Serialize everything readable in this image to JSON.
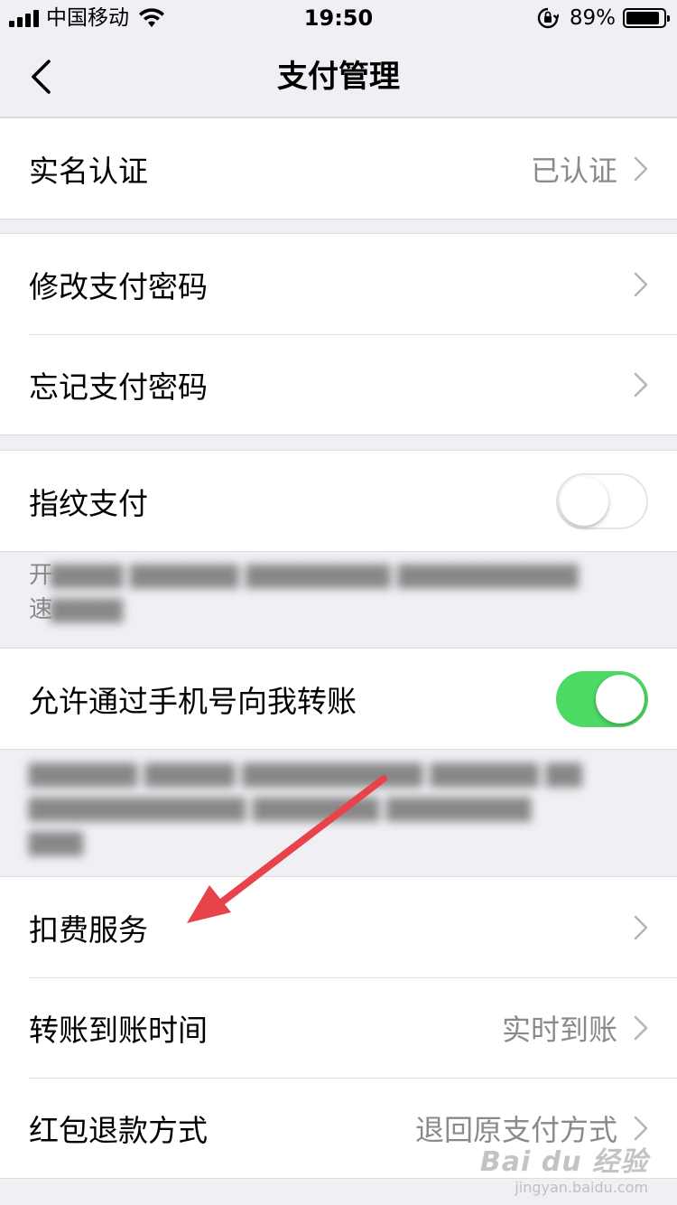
{
  "status_bar": {
    "carrier": "中国移动",
    "time": "19:50",
    "battery_percent": "89%",
    "battery_level": 0.89
  },
  "nav": {
    "title": "支付管理",
    "back_icon": "chevron-left-icon"
  },
  "groups": [
    {
      "items": [
        {
          "label": "实名认证",
          "value": "已认证"
        }
      ]
    },
    {
      "items": [
        {
          "label": "修改支付密码",
          "value": ""
        },
        {
          "label": "忘记支付密码",
          "value": ""
        }
      ]
    },
    {
      "items": [
        {
          "label": "指纹支付",
          "toggle": false
        }
      ],
      "note_prefix": "开\n速"
    },
    {
      "items": [
        {
          "label": "允许通过手机号向我转账",
          "toggle": true
        }
      ]
    },
    {
      "items": [
        {
          "label": "扣费服务",
          "value": ""
        },
        {
          "label": "转账到账时间",
          "value": "实时到账"
        },
        {
          "label": "红包退款方式",
          "value": "退回原支付方式"
        }
      ]
    }
  ],
  "colors": {
    "toggle_on": "#4cd964",
    "annotation_arrow": "#e8434a",
    "background": "#efeff4"
  },
  "watermark": {
    "logo": "Bai du 经验",
    "sub": "jingyan.baidu.com"
  }
}
